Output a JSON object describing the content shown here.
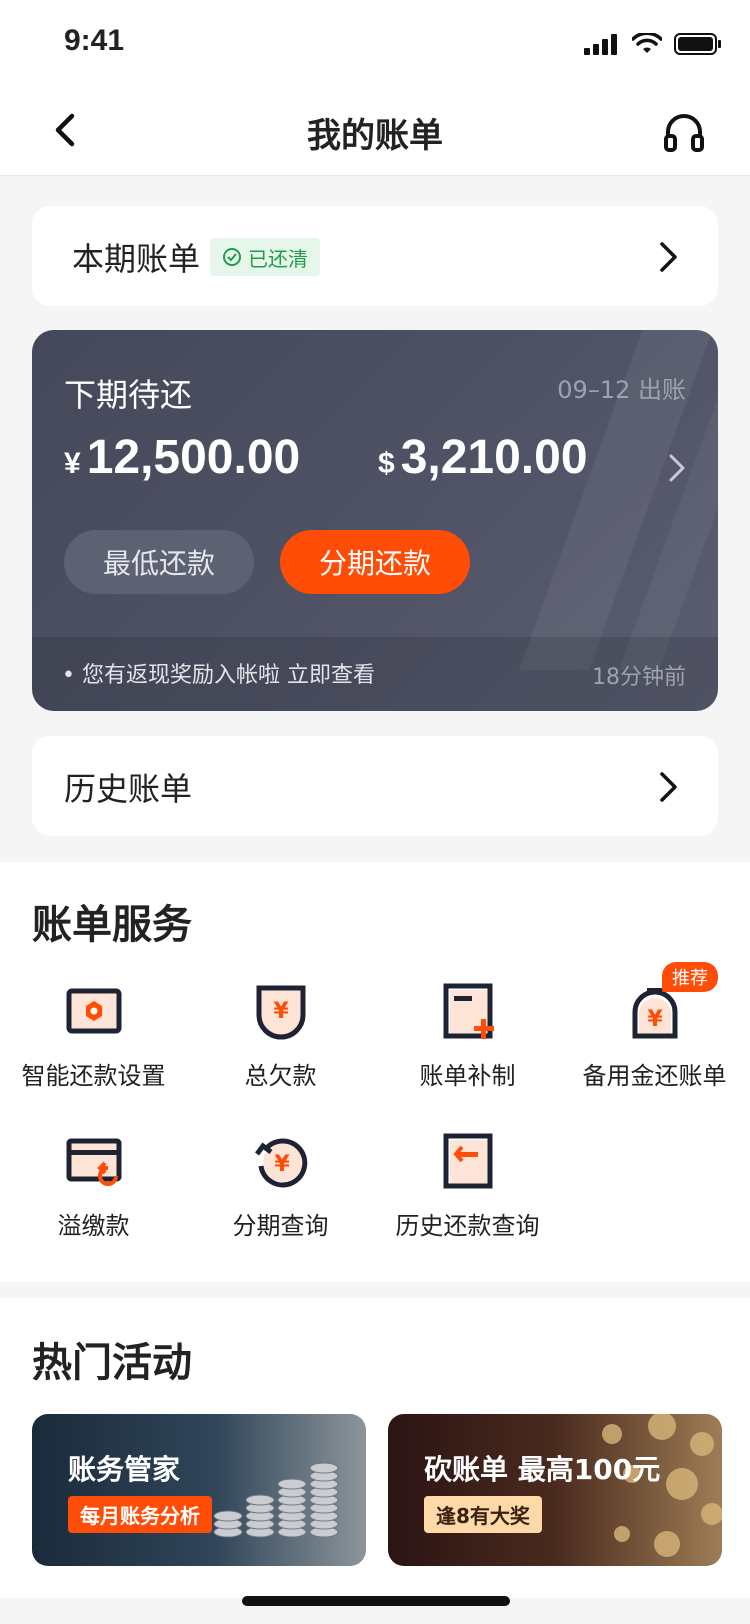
{
  "status_bar": {
    "time": "9:41"
  },
  "nav": {
    "title": "我的账单"
  },
  "current_bill": {
    "label": "本期账单",
    "badge": "已还清"
  },
  "next_bill": {
    "title": "下期待还",
    "bill_date": "09–12 出账",
    "cny_symbol": "¥",
    "cny_amount": "12,500.00",
    "usd_symbol": "$",
    "usd_amount": "3,210.00",
    "min_payment_label": "最低还款",
    "installment_label": "分期还款",
    "notice": "• 您有返现奖励入帐啦  立即查看",
    "notice_time": "18分钟前"
  },
  "history_bill": {
    "label": "历史账单"
  },
  "services": {
    "title": "账单服务",
    "recommend_badge": "推荐",
    "items": [
      {
        "label": "智能还款设置",
        "icon": "smart-repay-icon"
      },
      {
        "label": "总欠款",
        "icon": "total-debt-icon"
      },
      {
        "label": "账单补制",
        "icon": "bill-reissue-icon"
      },
      {
        "label": "备用金还账单",
        "icon": "reserve-fund-icon"
      },
      {
        "label": "溢缴款",
        "icon": "overpayment-icon"
      },
      {
        "label": "分期查询",
        "icon": "installment-query-icon"
      },
      {
        "label": "历史还款查询",
        "icon": "history-repay-icon"
      }
    ]
  },
  "hot": {
    "title": "热门活动",
    "promos": [
      {
        "title": "账务管家",
        "tag": "每月账务分析"
      },
      {
        "title": "砍账单  最高100元",
        "tag": "逢8有大奖"
      }
    ]
  },
  "colors": {
    "accent": "#ff4d08",
    "dark_card": "#4a4e60",
    "paid_green": "#1f9d48",
    "icon_navy": "#1d2333"
  }
}
